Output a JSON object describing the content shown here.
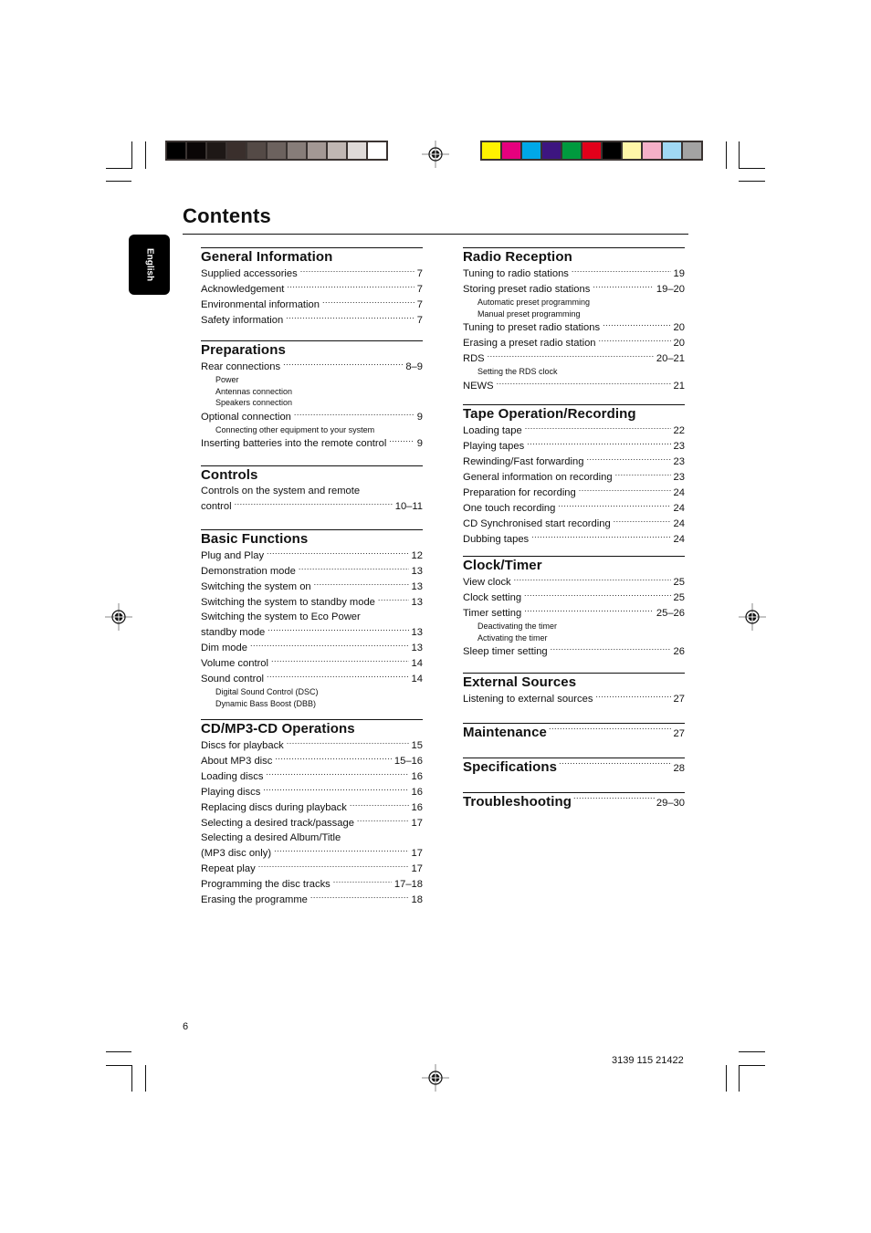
{
  "page": {
    "title": "Contents",
    "language_tab": "English",
    "page_number": "6",
    "doc_code": "3139 115 21422"
  },
  "color_bars": {
    "grayscale": [
      "#000000",
      "#0a0606",
      "#1e1816",
      "#3a2f2c",
      "#544a46",
      "#6c625e",
      "#877d79",
      "#a39894",
      "#c0b7b3",
      "#dfdad8",
      "#ffffff"
    ],
    "colors": [
      "#fff200",
      "#e6007e",
      "#00a8e8",
      "#3d1580",
      "#009a3e",
      "#e2001a",
      "#000000",
      "#fff6a8",
      "#f6b0c8",
      "#a0d8f4",
      "#a3a3a3"
    ]
  },
  "left_column": [
    {
      "heading": "General Information",
      "entries": [
        {
          "type": "entry",
          "label": "Supplied accessories",
          "page": "7"
        },
        {
          "type": "entry",
          "label": "Acknowledgement",
          "page": "7"
        },
        {
          "type": "entry",
          "label": "Environmental information",
          "page": "7"
        },
        {
          "type": "entry",
          "label": "Safety information",
          "page": "7"
        }
      ]
    },
    {
      "heading": "Preparations",
      "entries": [
        {
          "type": "entry",
          "label": "Rear connections",
          "page": "8–9"
        },
        {
          "type": "sub",
          "label": "Power"
        },
        {
          "type": "sub",
          "label": "Antennas connection"
        },
        {
          "type": "sub",
          "label": "Speakers connection"
        },
        {
          "type": "entry",
          "label": "Optional connection",
          "page": "9"
        },
        {
          "type": "sub",
          "label": "Connecting other equipment to your system"
        },
        {
          "type": "entry",
          "label": "Inserting batteries into the remote control",
          "page": "9"
        }
      ]
    },
    {
      "heading": "Controls",
      "entries": [
        {
          "type": "plain",
          "label": "Controls on the system and remote"
        },
        {
          "type": "entry",
          "label": "control",
          "page": "10–11"
        }
      ]
    },
    {
      "heading": "Basic Functions",
      "entries": [
        {
          "type": "entry",
          "label": "Plug and Play",
          "page": "12"
        },
        {
          "type": "entry",
          "label": "Demonstration mode",
          "page": "13"
        },
        {
          "type": "entry",
          "label": "Switching the system on",
          "page": "13"
        },
        {
          "type": "entry",
          "label": "Switching the system to standby mode",
          "page": "13"
        },
        {
          "type": "plain",
          "label": "Switching the system to Eco Power"
        },
        {
          "type": "entry",
          "label": "standby mode",
          "page": "13"
        },
        {
          "type": "entry",
          "label": "Dim mode",
          "page": "13"
        },
        {
          "type": "entry",
          "label": "Volume control",
          "page": "14"
        },
        {
          "type": "entry",
          "label": "Sound control",
          "page": "14"
        },
        {
          "type": "sub",
          "label": "Digital Sound Control (DSC)"
        },
        {
          "type": "sub",
          "label": "Dynamic Bass Boost (DBB)"
        }
      ]
    },
    {
      "heading": "CD/MP3-CD Operations",
      "entries": [
        {
          "type": "entry",
          "label": "Discs for playback",
          "page": "15"
        },
        {
          "type": "entry",
          "label": "About MP3 disc",
          "page": "15–16"
        },
        {
          "type": "entry",
          "label": "Loading discs",
          "page": "16"
        },
        {
          "type": "entry",
          "label": "Playing discs",
          "page": "16"
        },
        {
          "type": "entry",
          "label": "Replacing discs during playback",
          "page": "16"
        },
        {
          "type": "entry",
          "label": "Selecting a desired track/passage",
          "page": "17"
        },
        {
          "type": "plain",
          "label": "Selecting a desired Album/Title"
        },
        {
          "type": "entry",
          "label": "(MP3 disc only)",
          "page": "17"
        },
        {
          "type": "entry",
          "label": "Repeat play",
          "page": "17"
        },
        {
          "type": "entry",
          "label": "Programming the disc tracks",
          "page": "17–18"
        },
        {
          "type": "entry",
          "label": "Erasing the programme",
          "page": "18"
        }
      ]
    }
  ],
  "right_column": [
    {
      "heading": "Radio Reception",
      "entries": [
        {
          "type": "entry",
          "label": "Tuning to radio stations",
          "page": "19"
        },
        {
          "type": "entry",
          "label": "Storing preset radio stations",
          "page": "19–20"
        },
        {
          "type": "sub",
          "label": "Automatic preset programming"
        },
        {
          "type": "sub",
          "label": "Manual preset programming"
        },
        {
          "type": "entry",
          "label": "Tuning to preset radio stations",
          "page": "20"
        },
        {
          "type": "entry",
          "label": "Erasing a preset radio station",
          "page": "20"
        },
        {
          "type": "entry",
          "label": "RDS",
          "page": "20–21"
        },
        {
          "type": "sub",
          "label": "Setting the RDS clock"
        },
        {
          "type": "entry",
          "label": "NEWS",
          "page": "21"
        }
      ]
    },
    {
      "heading": "Tape Operation/Recording",
      "entries": [
        {
          "type": "entry",
          "label": "Loading tape",
          "page": "22"
        },
        {
          "type": "entry",
          "label": "Playing tapes",
          "page": "23"
        },
        {
          "type": "entry",
          "label": "Rewinding/Fast forwarding",
          "page": "23"
        },
        {
          "type": "entry",
          "label": "General information on recording",
          "page": "23"
        },
        {
          "type": "entry",
          "label": "Preparation for recording",
          "page": "24"
        },
        {
          "type": "entry",
          "label": "One touch recording",
          "page": "24"
        },
        {
          "type": "entry",
          "label": "CD Synchronised start recording",
          "page": "24"
        },
        {
          "type": "entry",
          "label": "Dubbing tapes",
          "page": "24"
        }
      ]
    },
    {
      "heading": "Clock/Timer",
      "entries": [
        {
          "type": "entry",
          "label": "View clock",
          "page": "25"
        },
        {
          "type": "entry",
          "label": "Clock setting",
          "page": "25"
        },
        {
          "type": "entry",
          "label": "Timer setting",
          "page": "25–26"
        },
        {
          "type": "sub",
          "label": "Deactivating the timer"
        },
        {
          "type": "sub",
          "label": "Activating the timer"
        },
        {
          "type": "entry",
          "label": "Sleep timer setting",
          "page": "26"
        }
      ]
    },
    {
      "heading": "External Sources",
      "entries": [
        {
          "type": "entry",
          "label": "Listening to external sources",
          "page": "27"
        }
      ]
    },
    {
      "heading": "Maintenance",
      "page": "27"
    },
    {
      "heading": "Specifications",
      "page": "28"
    },
    {
      "heading": "Troubleshooting",
      "page": "29–30"
    }
  ]
}
